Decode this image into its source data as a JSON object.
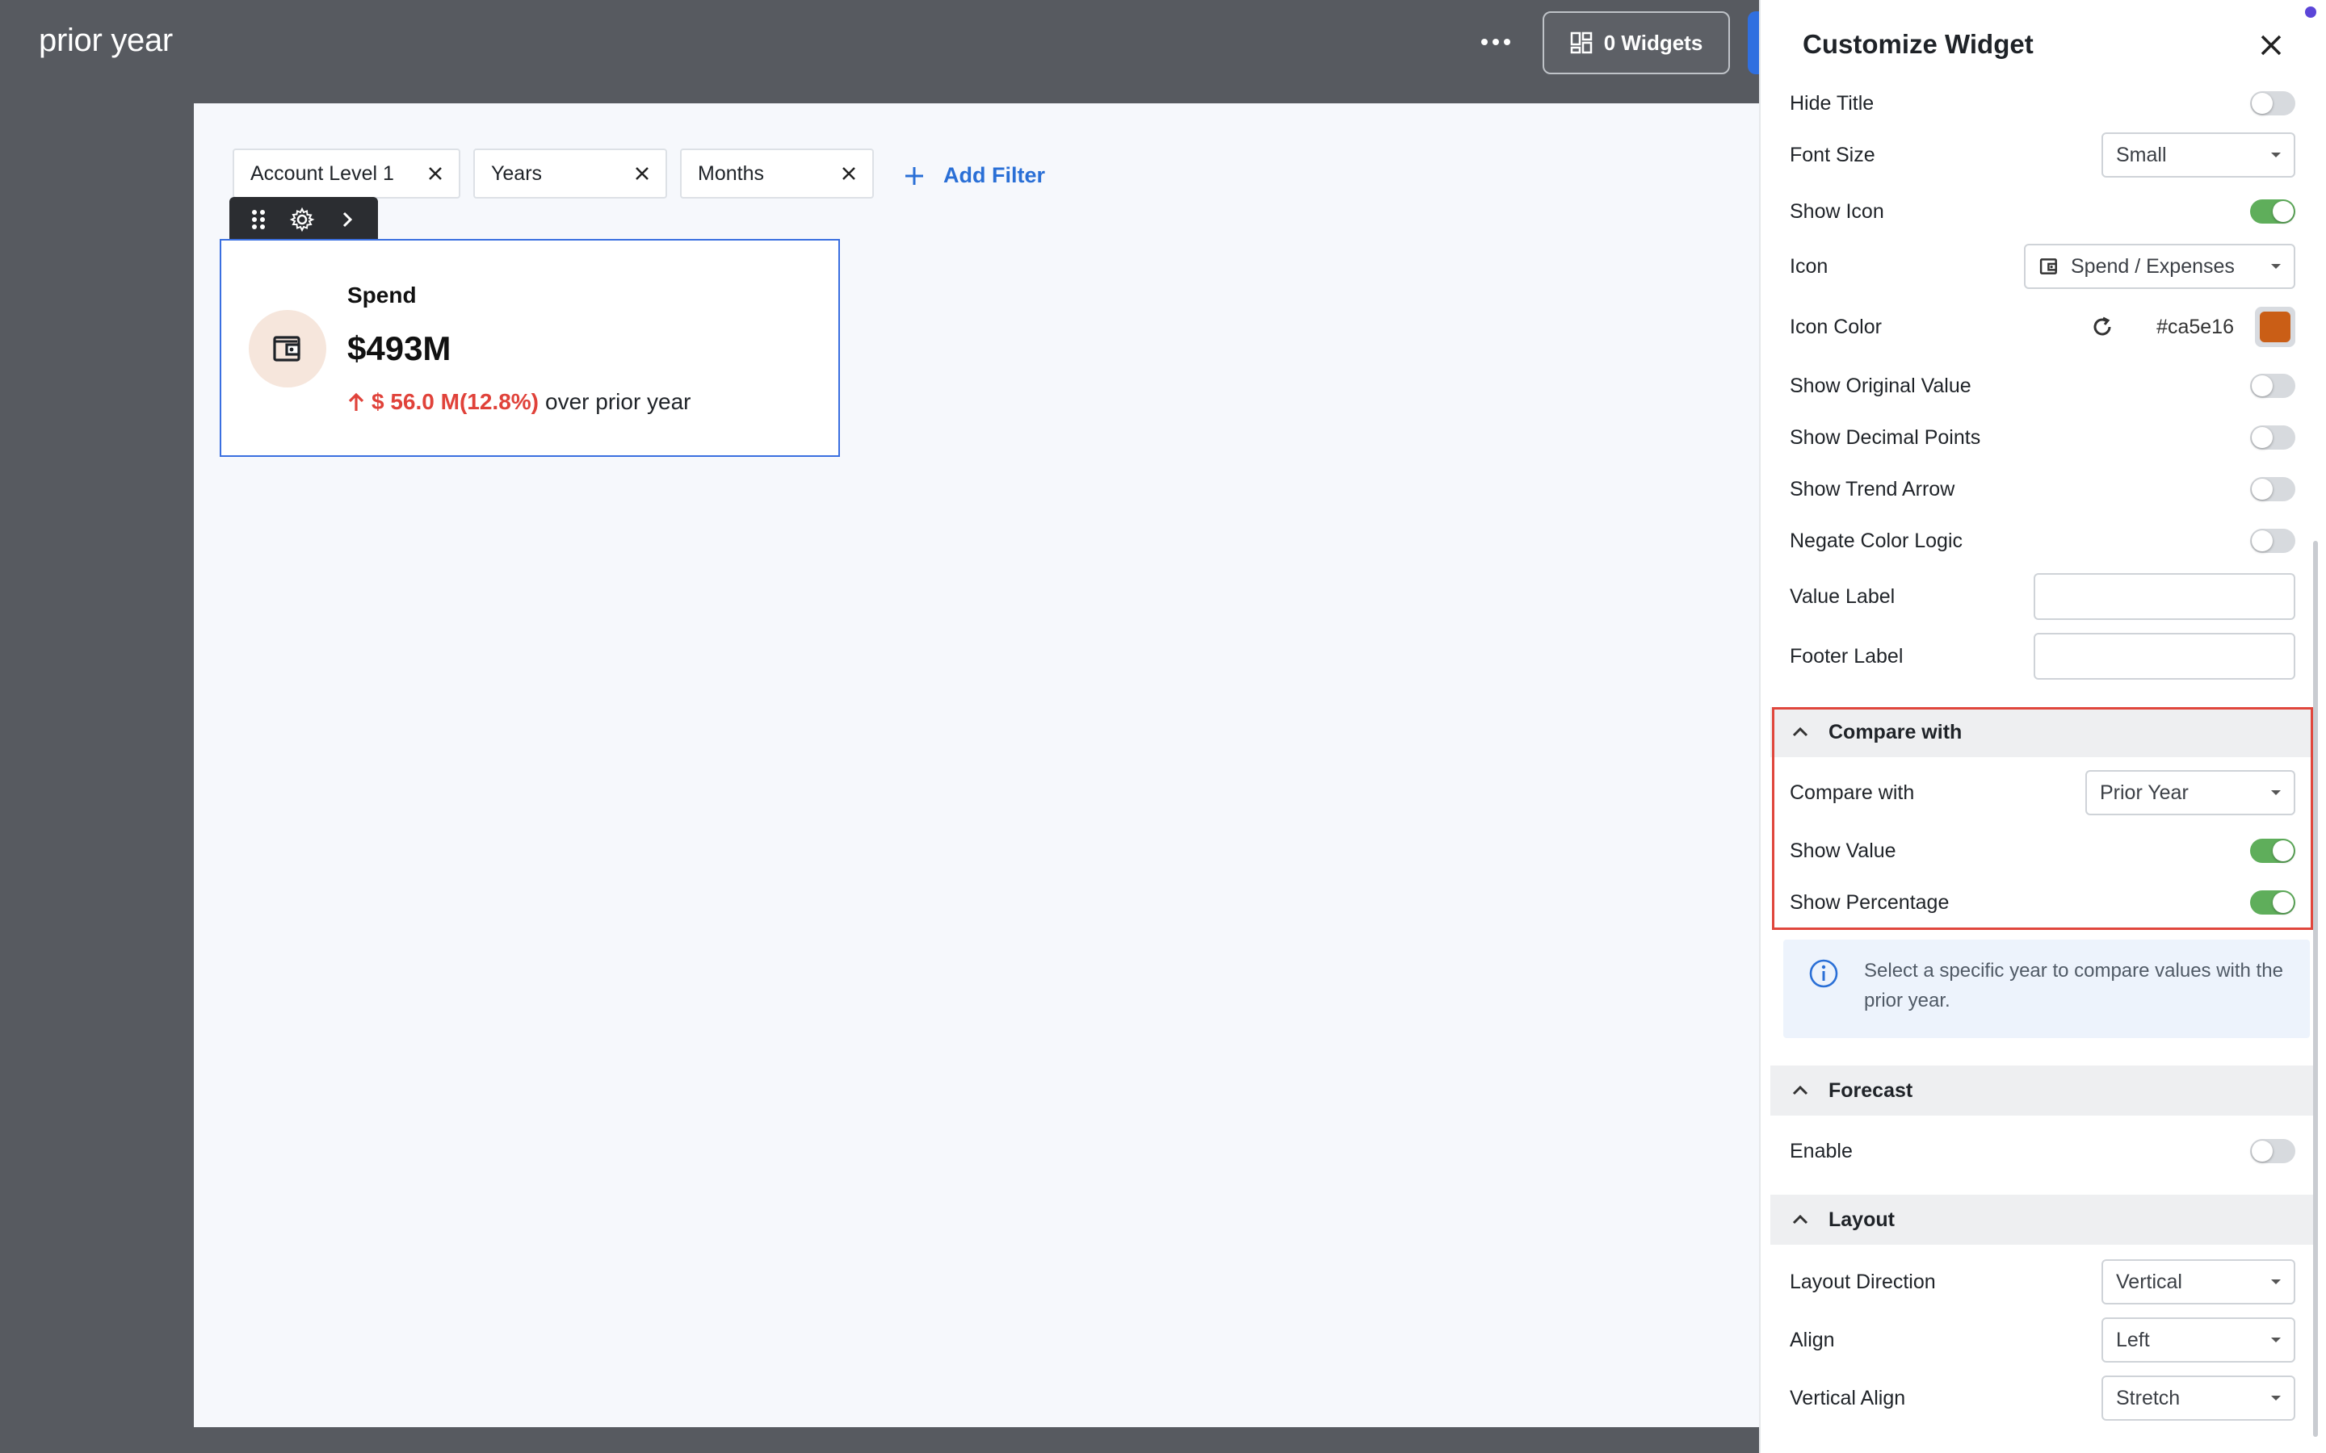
{
  "header": {
    "title": "prior year",
    "widgets_button_label": "0 Widgets"
  },
  "filters": [
    {
      "label": "Account Level 1"
    },
    {
      "label": "Years"
    },
    {
      "label": "Months"
    }
  ],
  "add_filter_label": "Add Filter",
  "kpi_widget": {
    "title": "Spend",
    "value": "$493M",
    "delta": "$ 56.0 M(12.8%)",
    "suffix": "over prior year",
    "trend": "up",
    "icon": "wallet-icon",
    "icon_color": "#ca5e16",
    "icon_bg": "#f6e6dc",
    "delta_color": "#e0423a"
  },
  "panel": {
    "title": "Customize Widget",
    "rows": {
      "hide_title": {
        "label": "Hide Title",
        "on": false
      },
      "font_size": {
        "label": "Font Size",
        "value": "Small"
      },
      "show_icon": {
        "label": "Show Icon",
        "on": true
      },
      "icon": {
        "label": "Icon",
        "value": "Spend / Expenses"
      },
      "icon_color": {
        "label": "Icon Color",
        "value": "#ca5e16"
      },
      "show_original_value": {
        "label": "Show Original Value",
        "on": false
      },
      "show_decimal_points": {
        "label": "Show Decimal Points",
        "on": false
      },
      "show_trend_arrow": {
        "label": "Show Trend Arrow",
        "on": false
      },
      "negate_color_logic": {
        "label": "Negate Color Logic",
        "on": false
      },
      "value_label": {
        "label": "Value Label",
        "value": ""
      },
      "footer_label": {
        "label": "Footer Label",
        "value": ""
      }
    },
    "compare_section": {
      "title": "Compare with",
      "compare_with": {
        "label": "Compare with",
        "value": "Prior Year"
      },
      "show_value": {
        "label": "Show Value",
        "on": true
      },
      "show_percentage": {
        "label": "Show Percentage",
        "on": true
      },
      "info": "Select a specific year to compare values with the prior year."
    },
    "forecast_section": {
      "title": "Forecast",
      "enable": {
        "label": "Enable",
        "on": false
      }
    },
    "layout_section": {
      "title": "Layout",
      "layout_direction": {
        "label": "Layout Direction",
        "value": "Vertical"
      },
      "align": {
        "label": "Align",
        "value": "Left"
      },
      "vertical_align": {
        "label": "Vertical Align",
        "value": "Stretch"
      }
    }
  },
  "colors": {
    "accent_blue": "#2a6fd6",
    "toggle_on": "#5fae5b",
    "highlight_red": "#e0463c"
  }
}
